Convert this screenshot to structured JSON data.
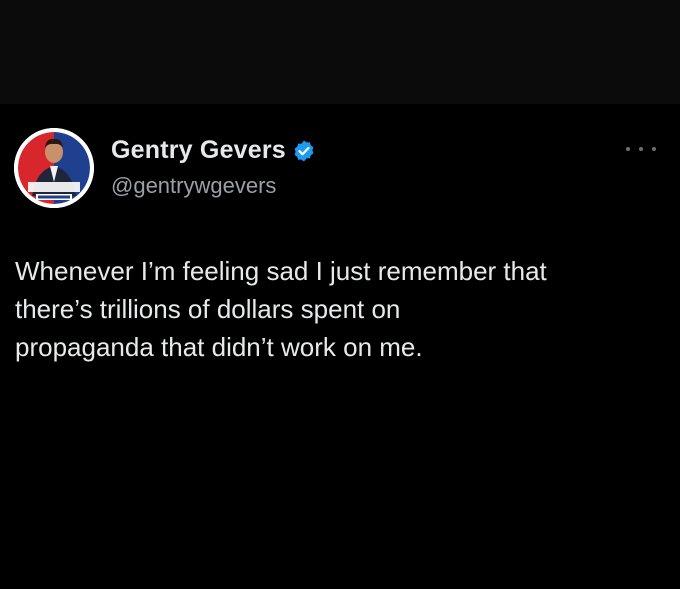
{
  "tweet": {
    "author": {
      "display_name": "Gentry Gevers",
      "handle": "@gentrywgevers",
      "verified": true
    },
    "text": "Whenever I’m feeling sad I just remember that\nthere’s trillions of dollars spent on\npropaganda that didn’t work on me."
  },
  "icons": {
    "verified": "verified-badge-icon",
    "more": "more-options-icon"
  },
  "colors": {
    "background": "#000000",
    "text": "#e7e9ea",
    "secondary_text": "#9aa0a6",
    "verified_blue": "#1d9bf0"
  }
}
